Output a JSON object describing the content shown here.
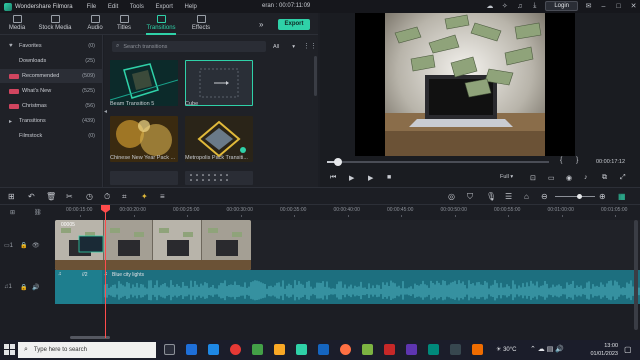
{
  "titlebar": {
    "app_name": "Wondershare Filmora",
    "menus": [
      "File",
      "Edit",
      "Tools",
      "Export",
      "Help"
    ],
    "project_info": "eran : 00:07:11:09",
    "login_label": "Login"
  },
  "toolbar": {
    "tabs": [
      {
        "label": "Media",
        "icon": "folder-icon"
      },
      {
        "label": "Stock Media",
        "icon": "cloud-icon"
      },
      {
        "label": "Audio",
        "icon": "music-icon"
      },
      {
        "label": "Titles",
        "icon": "title-icon"
      },
      {
        "label": "Transitions",
        "icon": "transition-icon"
      },
      {
        "label": "Effects",
        "icon": "effects-icon"
      }
    ],
    "active_tab": "Transitions",
    "export_label": "Export"
  },
  "categories": [
    {
      "label": "Favorites",
      "count": "(0)",
      "icon": "heart-icon"
    },
    {
      "label": "Downloads",
      "count": "(25)",
      "icon": "none"
    },
    {
      "label": "Recommended",
      "count": "(509)",
      "icon": "badge"
    },
    {
      "label": "What's New",
      "count": "(525)",
      "icon": "badge"
    },
    {
      "label": "Christmas",
      "count": "(56)",
      "icon": "badge"
    },
    {
      "label": "Transitions",
      "count": "(439)",
      "icon": "arrow-icon"
    },
    {
      "label": "Filmstock",
      "count": "(0)",
      "icon": "none"
    }
  ],
  "active_category": "Recommended",
  "search": {
    "placeholder": "Search transitions",
    "filter": "All"
  },
  "transitions": [
    {
      "label": "Beam Transition 5"
    },
    {
      "label": "Cube"
    },
    {
      "label": "Chinese New Year Pack ..."
    },
    {
      "label": "Metropolis Pack Transiti..."
    }
  ],
  "preview": {
    "time": "00:00:17:12",
    "progress": 0.05,
    "quality": "Full",
    "bracket_in": "{",
    "bracket_out": "}"
  },
  "timeline": {
    "ruler": [
      "00:00:15:00",
      "00:00:20:00",
      "00:00:25:00",
      "00:00:30:00",
      "00:00:35:00",
      "00:00:40:00",
      "00:00:45:00",
      "00:00:50:00",
      "00:00:55:00",
      "00:01:00:00",
      "00:01:05:00"
    ],
    "video_clip_label": "00005",
    "audio_clip_label": "Blue city lights",
    "audio_short_label": "//2"
  },
  "taskbar": {
    "search_placeholder": "Type here to search",
    "weather": "30°C",
    "time": "13:00",
    "date": "01/01/2023"
  },
  "colors": {
    "accent": "#2fd1a8",
    "playhead": "#ff4c4c",
    "audio": "#1d6f7f"
  }
}
